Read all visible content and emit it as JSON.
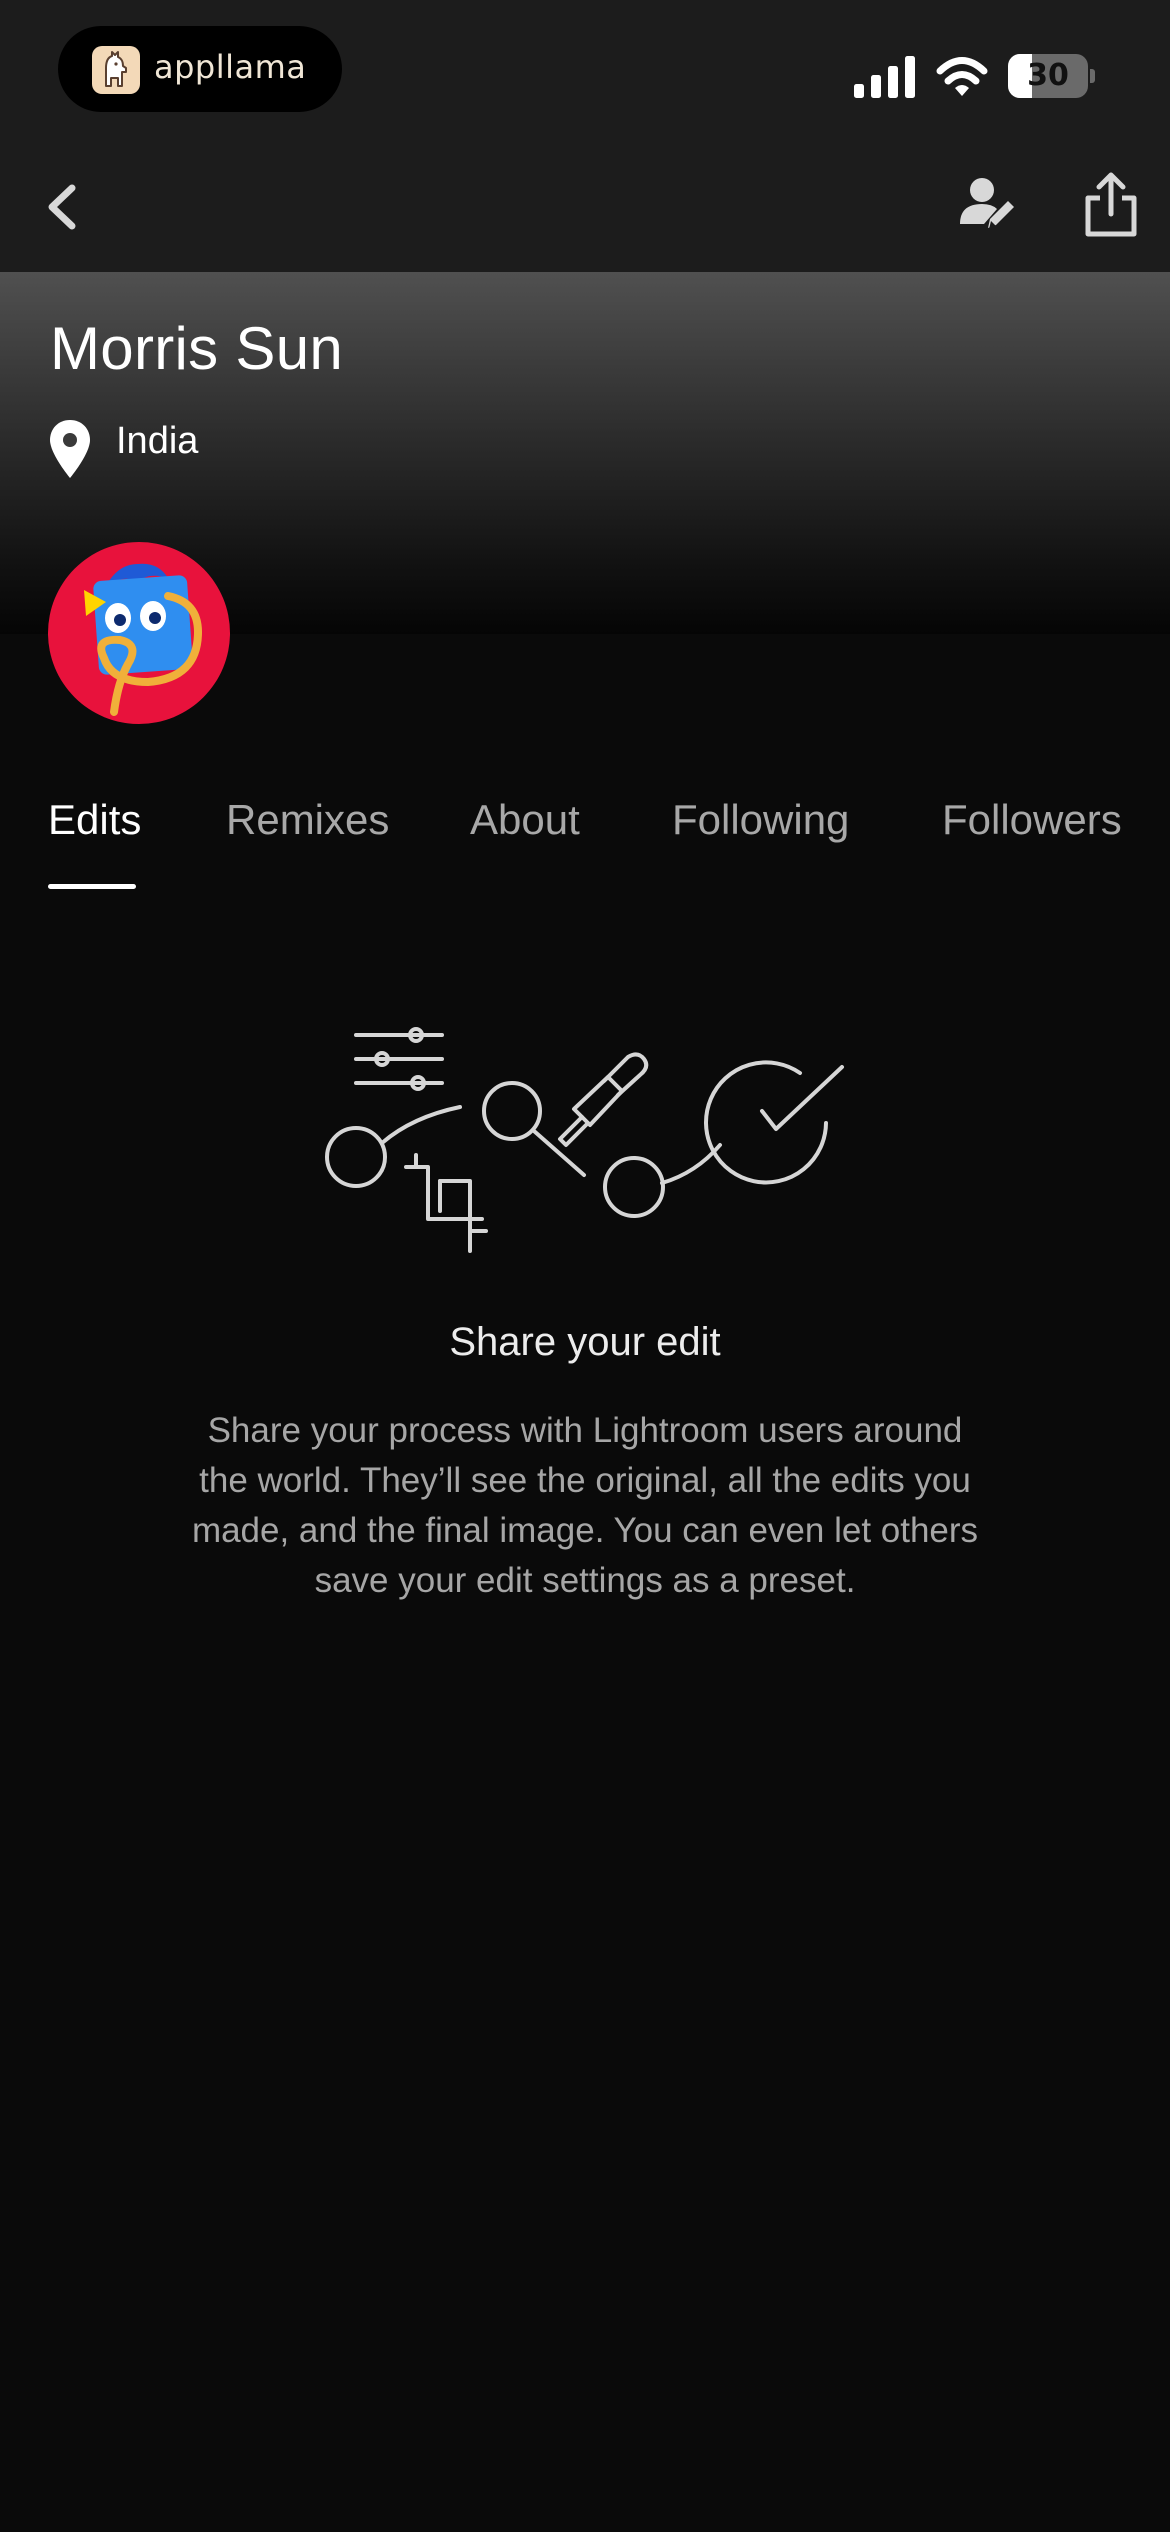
{
  "status_bar": {
    "app_pill_text": "appllama",
    "battery_percent": "30",
    "battery_level": 0.3
  },
  "nav": {
    "back_icon": "chevron-left-icon",
    "edit_profile_icon": "edit-profile-icon",
    "share_icon": "share-icon"
  },
  "profile": {
    "name": "Morris Sun",
    "location": "India",
    "avatar_bg_color": "#e8123c"
  },
  "tabs": [
    {
      "label": "Edits",
      "active": true
    },
    {
      "label": "Remixes",
      "active": false
    },
    {
      "label": "About",
      "active": false
    },
    {
      "label": "Following",
      "active": false
    },
    {
      "label": "Followers",
      "active": false
    }
  ],
  "empty_state": {
    "title": "Share your edit",
    "description": "Share your process with Lightroom users around the world. They’ll see the original, all the edits you made, and the final image. You can even let others save your edit settings as a preset."
  },
  "colors": {
    "background": "#0a0a0a",
    "bar": "#1c1c1c",
    "tab_active": "#ffffff",
    "tab_inactive": "#a8a8a8"
  }
}
